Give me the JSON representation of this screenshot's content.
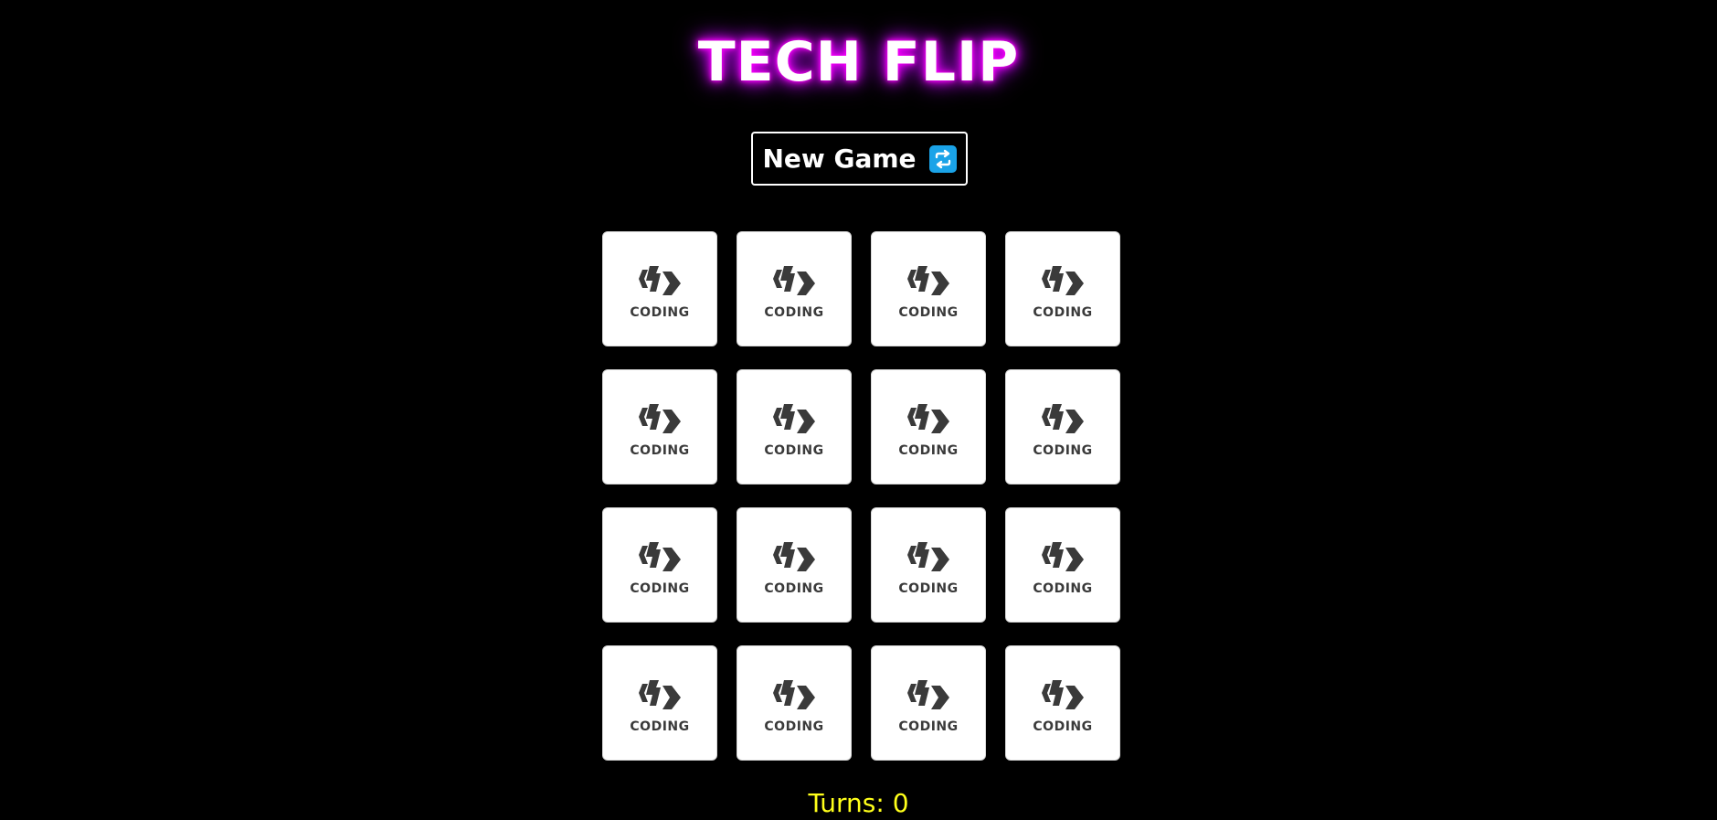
{
  "game": {
    "title": "TECH FLIP",
    "new_game_label": "New Game",
    "new_game_icon": "refresh-icon",
    "turns_label": "Turns:",
    "turns_value": "0"
  },
  "colors": {
    "background": "#000000",
    "title_glow": "#ff00ff",
    "card_face": "#ffffff",
    "turns_text": "#ffff1a",
    "refresh_icon_bg": "#1aa3e8"
  },
  "cards": [
    {
      "label": "CODING",
      "icon": "coding-logo-icon"
    },
    {
      "label": "CODING",
      "icon": "coding-logo-icon"
    },
    {
      "label": "CODING",
      "icon": "coding-logo-icon"
    },
    {
      "label": "CODING",
      "icon": "coding-logo-icon"
    },
    {
      "label": "CODING",
      "icon": "coding-logo-icon"
    },
    {
      "label": "CODING",
      "icon": "coding-logo-icon"
    },
    {
      "label": "CODING",
      "icon": "coding-logo-icon"
    },
    {
      "label": "CODING",
      "icon": "coding-logo-icon"
    },
    {
      "label": "CODING",
      "icon": "coding-logo-icon"
    },
    {
      "label": "CODING",
      "icon": "coding-logo-icon"
    },
    {
      "label": "CODING",
      "icon": "coding-logo-icon"
    },
    {
      "label": "CODING",
      "icon": "coding-logo-icon"
    },
    {
      "label": "CODING",
      "icon": "coding-logo-icon"
    },
    {
      "label": "CODING",
      "icon": "coding-logo-icon"
    },
    {
      "label": "CODING",
      "icon": "coding-logo-icon"
    },
    {
      "label": "CODING",
      "icon": "coding-logo-icon"
    }
  ]
}
